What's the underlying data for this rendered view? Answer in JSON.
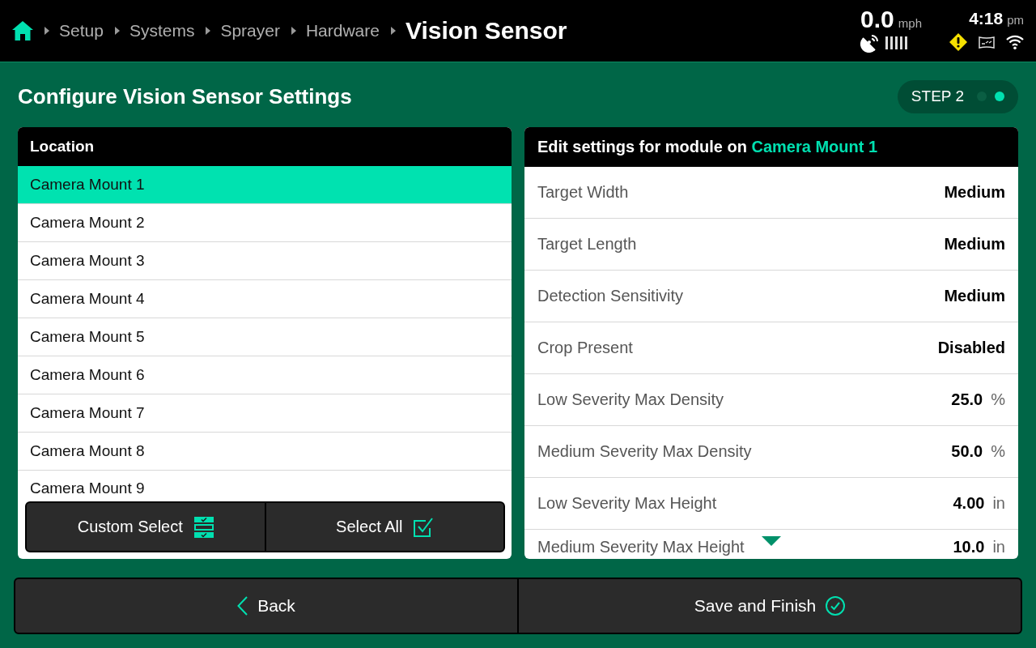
{
  "status_bar": {
    "breadcrumbs": [
      {
        "label": "Setup"
      },
      {
        "label": "Systems"
      },
      {
        "label": "Sprayer"
      },
      {
        "label": "Hardware"
      }
    ],
    "title": "Vision Sensor",
    "speed": {
      "value": "0.0",
      "unit": "mph"
    },
    "time": {
      "value": "4:18",
      "period": "pm"
    }
  },
  "page": {
    "title": "Configure Vision Sensor Settings",
    "step": {
      "label": "STEP 2",
      "dots": [
        {
          "selected": false
        },
        {
          "selected": true
        }
      ]
    }
  },
  "location_panel": {
    "heading": "Location",
    "items": [
      {
        "label": "Camera Mount 1",
        "selected": true
      },
      {
        "label": "Camera Mount 2",
        "selected": false
      },
      {
        "label": "Camera Mount 3",
        "selected": false
      },
      {
        "label": "Camera Mount 4",
        "selected": false
      },
      {
        "label": "Camera Mount 5",
        "selected": false
      },
      {
        "label": "Camera Mount 6",
        "selected": false
      },
      {
        "label": "Camera Mount 7",
        "selected": false
      },
      {
        "label": "Camera Mount 8",
        "selected": false
      },
      {
        "label": "Camera Mount 9",
        "selected": false
      }
    ],
    "actions": [
      {
        "label": "Custom Select",
        "kind": "custom"
      },
      {
        "label": "Select All",
        "kind": "all"
      }
    ]
  },
  "settings_panel": {
    "heading": "Edit settings for module on",
    "module": "Camera Mount 1",
    "rows": [
      {
        "label": "Target Width",
        "value": "Medium"
      },
      {
        "label": "Target Length",
        "value": "Medium"
      },
      {
        "label": "Detection Sensitivity",
        "value": "Medium"
      },
      {
        "label": "Crop Present",
        "value": "Disabled"
      },
      {
        "label": "Low Severity Max Density",
        "value": "25.0",
        "unit": "%"
      },
      {
        "label": "Medium Severity Max Density",
        "value": "50.0",
        "unit": "%"
      },
      {
        "label": "Low Severity Max Height",
        "value": "4.00",
        "unit": "in"
      },
      {
        "label": "Medium Severity Max Height",
        "value": "10.0",
        "unit": "in"
      }
    ]
  },
  "footer": {
    "buttons": [
      {
        "label": "Back",
        "kind": "back"
      },
      {
        "label": "Save and Finish",
        "kind": "finish"
      }
    ]
  }
}
